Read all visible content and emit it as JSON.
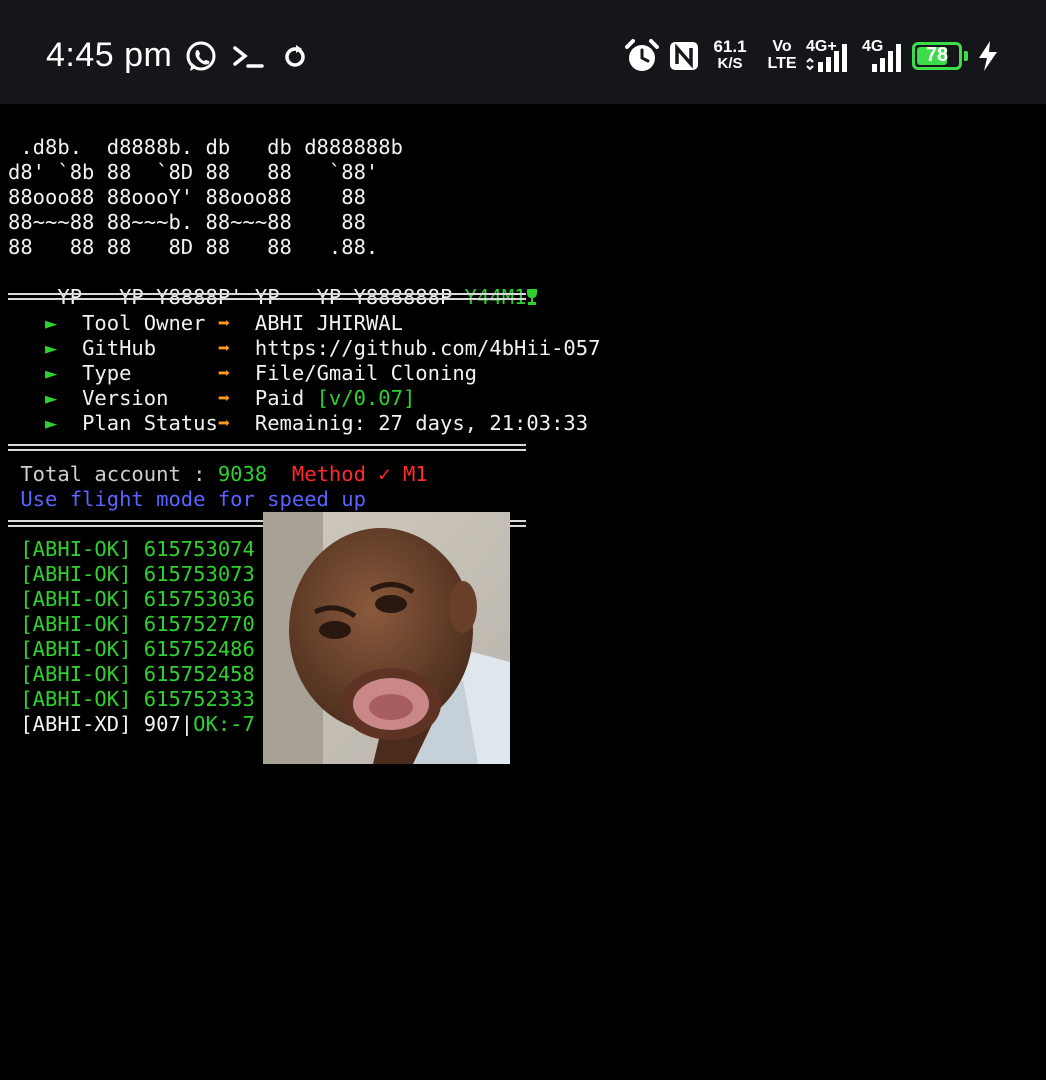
{
  "status_bar": {
    "time": "4:45 pm",
    "net_speed_value": "61.1",
    "net_speed_unit": "K/S",
    "volte_top": "Vo",
    "volte_bottom": "LTE",
    "sim1_label": "4G+",
    "sim2_label": "4G",
    "battery_level": "78",
    "battery_fraction": 0.78,
    "icons": [
      "whatsapp-icon",
      "terminal-icon",
      "sync-icon",
      "alarm-icon",
      "nfc-icon",
      "signal-icon",
      "battery-icon",
      "charging-icon"
    ]
  },
  "banner": {
    "line1": " .d8b.  d8888b. db   db d888888b",
    "line2": "d8' `8b 88  `8D 88   88   `88'",
    "line3": "88ooo88 88oooY' 88ooo88    88",
    "line4": "88~~~88 88~~~b. 88~~~88    88",
    "line5": "88   88 88   8D 88   88   .88.",
    "line6": "YP   YP Y8888P' YP   YP Y888888P",
    "tag": "Y44M1"
  },
  "info": {
    "rows": [
      {
        "bullet": "►",
        "label": "Tool Owner ",
        "arrow": "➡",
        "value": "ABHI JHIRWAL",
        "extra": ""
      },
      {
        "bullet": "►",
        "label": "GitHub     ",
        "arrow": "➡",
        "value": "https://github.com/4bHii-057",
        "extra": ""
      },
      {
        "bullet": "►",
        "label": "Type       ",
        "arrow": "➡",
        "value": "File/Gmail Cloning",
        "extra": ""
      },
      {
        "bullet": "►",
        "label": "Version    ",
        "arrow": "➡",
        "value": "Paid ",
        "extra": "[v/0.07]"
      },
      {
        "bullet": "►",
        "label": "Plan Status",
        "arrow": "➡",
        "value": "Remainig: 27 days, 21:03:33",
        "extra": ""
      }
    ]
  },
  "summary": {
    "total_label": " Total account : ",
    "total_value": "9038",
    "method_label": "  Method ✓ M1",
    "hint": " Use flight mode for speed up"
  },
  "results": {
    "ok_prefix": " [ABHI-OK] ",
    "ok_ids": [
      "615753074",
      "615753073",
      "615753036",
      "615752770",
      "615752486",
      "615752458",
      "615752333"
    ],
    "progress_prefix": " [ABHI-XD] 907",
    "progress_sep": "|",
    "progress_ok": "OK:-7"
  },
  "colors": {
    "status_bg": "#15161a",
    "terminal_bg": "#000000",
    "green": "#2fd12f",
    "red": "#ff2a2a",
    "orange": "#ff9a1f",
    "blue": "#5a63ff",
    "battery": "#3ddc4a"
  }
}
